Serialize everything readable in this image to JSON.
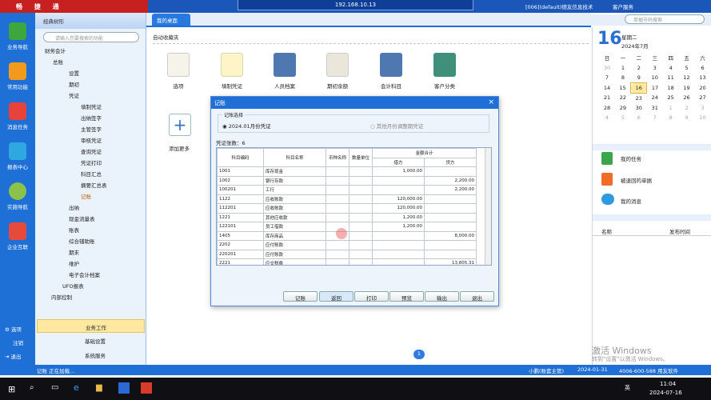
{
  "window": {
    "brand": "畅 捷 通",
    "remote_ip": "192.168.10.13",
    "title_right": "[006](default)德友信息技术",
    "service": "客户服务",
    "search_placeholder": "单据号码搜索"
  },
  "leftnav": [
    {
      "label": "业务导航"
    },
    {
      "label": "常用功能"
    },
    {
      "label": "消息任务"
    },
    {
      "label": "报表中心"
    },
    {
      "label": "实施导航"
    },
    {
      "label": "企业互联"
    }
  ],
  "leftnav_bottom": [
    {
      "label": "选项"
    },
    {
      "label": "注销"
    },
    {
      "label": "退出"
    }
  ],
  "tree": {
    "header": "经典树形",
    "search_placeholder": "请输入您要搜索的功能",
    "nodes": [
      {
        "label": "财务会计"
      },
      {
        "label": "总账"
      },
      {
        "label": "设置"
      },
      {
        "label": "期初"
      },
      {
        "label": "凭证"
      },
      {
        "label": "填制凭证"
      },
      {
        "label": "出纳签字"
      },
      {
        "label": "主管签字"
      },
      {
        "label": "审核凭证"
      },
      {
        "label": "查询凭证"
      },
      {
        "label": "凭证打印"
      },
      {
        "label": "科目汇总"
      },
      {
        "label": "摘要汇总表"
      },
      {
        "label": "记账"
      },
      {
        "label": "出纳"
      },
      {
        "label": "现金流量表"
      },
      {
        "label": "账表"
      },
      {
        "label": "综合辅助账"
      },
      {
        "label": "期末"
      },
      {
        "label": "维护"
      },
      {
        "label": "电子会计档案"
      },
      {
        "label": "UFO报表"
      },
      {
        "label": "内部控制"
      }
    ],
    "bottom": [
      {
        "label": "业务工作"
      },
      {
        "label": "基础设置"
      },
      {
        "label": "系统服务"
      }
    ]
  },
  "tabs": {
    "active": "我的桌面"
  },
  "main": {
    "section": "自动收藏夹",
    "add_more": "添加更多",
    "favorites": [
      {
        "label": "选项"
      },
      {
        "label": "填制凭证"
      },
      {
        "label": "人员档案"
      },
      {
        "label": "期初余额"
      },
      {
        "label": "会计科目"
      },
      {
        "label": "客户分类"
      }
    ],
    "page": "1"
  },
  "dialog": {
    "title": "记账",
    "group_label": "记账选择",
    "radio1": "2024.01月份凭证",
    "radio2": "其他月份调整期凭证",
    "count": "凭证张数：6",
    "columns": [
      "科目编码",
      "科目名称",
      "币种名称",
      "数量单位",
      "金额合计",
      "借方",
      "贷方"
    ],
    "rows": [
      [
        "1001",
        "库存现金",
        "",
        "",
        "1,000.00",
        ""
      ],
      [
        "1002",
        "银行存款",
        "",
        "",
        "",
        "2,200.00"
      ],
      [
        "100201",
        "工行",
        "",
        "",
        "",
        "2,200.00"
      ],
      [
        "1122",
        "应收账款",
        "",
        "",
        "120,000.00",
        ""
      ],
      [
        "112201",
        "应收账款",
        "",
        "",
        "120,000.00",
        ""
      ],
      [
        "1221",
        "其他应收款",
        "",
        "",
        "1,200.00",
        ""
      ],
      [
        "122101",
        "员工借款",
        "",
        "",
        "1,200.00",
        ""
      ],
      [
        "1405",
        "库存商品",
        "",
        "",
        "",
        "8,000.00"
      ],
      [
        "2202",
        "应付账款",
        "",
        "",
        "",
        ""
      ],
      [
        "220201",
        "应付账款",
        "",
        "",
        "",
        ""
      ],
      [
        "2221",
        "应交税费",
        "",
        "",
        "",
        "13,805.31"
      ]
    ],
    "buttons": [
      "记账",
      "返回",
      "打印",
      "预览",
      "输出",
      "退出"
    ]
  },
  "calendar": {
    "day": "16",
    "weekday": "星期二",
    "month": "2024年7月",
    "head": [
      "日",
      "一",
      "二",
      "三",
      "四",
      "五",
      "六"
    ],
    "weeks": [
      [
        "30",
        "1",
        "2",
        "3",
        "4",
        "5",
        "6"
      ],
      [
        "7",
        "8",
        "9",
        "10",
        "11",
        "12",
        "13"
      ],
      [
        "14",
        "15",
        "16",
        "17",
        "18",
        "19",
        "20"
      ],
      [
        "21",
        "22",
        "23",
        "24",
        "25",
        "26",
        "27"
      ],
      [
        "28",
        "29",
        "30",
        "31",
        "1",
        "2",
        "3"
      ],
      [
        "4",
        "5",
        "6",
        "7",
        "8",
        "9",
        "10"
      ]
    ]
  },
  "tasks": [
    {
      "label": "我的任务"
    },
    {
      "label": "被退回的单据"
    },
    {
      "label": "我的消息"
    }
  ],
  "notice": {
    "col1": "名称",
    "col2": "发布时间"
  },
  "watermark": {
    "line1": "激活 Windows",
    "line2": "转到\"设置\"以激活 Windows。"
  },
  "status": {
    "left": "记账 正在加载...",
    "user": "小鹏(账套主管)",
    "date": "2024-01-31",
    "phone": "4006-600-588 用友软件"
  },
  "taskbar": {
    "time": "11:04",
    "date": "2024-07-16",
    "ime": "英"
  },
  "colors": {
    "nav_blue": "#1e6fd6",
    "brand_red": "#c62020"
  }
}
